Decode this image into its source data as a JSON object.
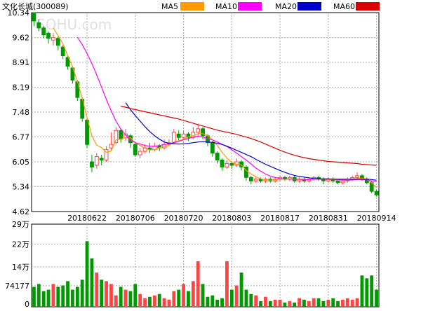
{
  "header": {
    "title": "文化长城(300089)",
    "watermark": "SOHU.com",
    "legend": [
      {
        "label": "MA5",
        "color": "#ff9900"
      },
      {
        "label": "MA10",
        "color": "#ff00ff"
      },
      {
        "label": "MA20",
        "color": "#0000cc"
      },
      {
        "label": "MA60",
        "color": "#dd0000"
      }
    ]
  },
  "colors": {
    "up": "#ff4444",
    "down": "#009900",
    "grid": "#aaaaaa",
    "axis": "#000000"
  },
  "chart_data": [
    {
      "type": "candlestick",
      "title": "文化长城(300089)",
      "y_ticks": [
        "10.34",
        "9.62",
        "8.91",
        "8.19",
        "7.48",
        "6.77",
        "6.05",
        "5.34",
        "4.62"
      ],
      "ylim": [
        4.62,
        10.34
      ],
      "x_ticks": [
        {
          "label": "20180622",
          "index": 11
        },
        {
          "label": "20180706",
          "index": 21
        },
        {
          "label": "20180720",
          "index": 31
        },
        {
          "label": "20180803",
          "index": 41
        },
        {
          "label": "20180817",
          "index": 51
        },
        {
          "label": "20180831",
          "index": 61
        },
        {
          "label": "20180914",
          "index": 71
        }
      ],
      "ohlc": [
        [
          10.34,
          10.1,
          10.3,
          9.95
        ],
        [
          10.05,
          9.9,
          10.15,
          9.8
        ],
        [
          9.9,
          9.7,
          9.95,
          9.6
        ],
        [
          9.75,
          9.6,
          9.8,
          9.45
        ],
        [
          9.55,
          9.62,
          9.75,
          9.4
        ],
        [
          9.6,
          9.4,
          9.65,
          9.25
        ],
        [
          9.35,
          9.1,
          9.4,
          9.0
        ],
        [
          9.05,
          8.8,
          9.1,
          8.7
        ],
        [
          8.75,
          8.4,
          8.8,
          8.3
        ],
        [
          8.35,
          7.9,
          8.4,
          7.8
        ],
        [
          7.85,
          7.3,
          7.9,
          7.2
        ],
        [
          7.25,
          6.55,
          7.3,
          6.45
        ],
        [
          6.05,
          5.9,
          6.25,
          5.75
        ],
        [
          5.95,
          6.2,
          6.3,
          5.85
        ],
        [
          6.15,
          6.1,
          6.25,
          5.95
        ],
        [
          6.1,
          6.4,
          6.5,
          6.05
        ],
        [
          6.45,
          6.55,
          6.9,
          6.4
        ],
        [
          6.6,
          6.95,
          7.05,
          6.55
        ],
        [
          6.95,
          6.7,
          7.0,
          6.6
        ],
        [
          6.75,
          6.85,
          7.0,
          6.65
        ],
        [
          6.8,
          6.6,
          6.85,
          6.45
        ],
        [
          6.55,
          6.25,
          6.6,
          6.2
        ],
        [
          6.25,
          6.35,
          6.45,
          6.15
        ],
        [
          6.35,
          6.45,
          6.55,
          6.3
        ],
        [
          6.45,
          6.4,
          6.6,
          6.3
        ],
        [
          6.4,
          6.5,
          6.6,
          6.35
        ],
        [
          6.5,
          6.45,
          6.55,
          6.35
        ],
        [
          6.45,
          6.55,
          6.7,
          6.4
        ],
        [
          6.55,
          6.6,
          6.7,
          6.5
        ],
        [
          6.6,
          6.9,
          7.0,
          6.55
        ],
        [
          6.85,
          6.75,
          6.95,
          6.65
        ],
        [
          6.75,
          6.85,
          6.95,
          6.7
        ],
        [
          6.85,
          6.75,
          6.9,
          6.65
        ],
        [
          6.75,
          6.9,
          7.05,
          6.7
        ],
        [
          6.9,
          7.0,
          7.15,
          6.8
        ],
        [
          7.0,
          6.8,
          7.05,
          6.7
        ],
        [
          6.8,
          6.6,
          6.85,
          6.5
        ],
        [
          6.6,
          6.3,
          6.65,
          6.2
        ],
        [
          6.3,
          6.1,
          6.35,
          6.0
        ],
        [
          6.1,
          5.9,
          6.15,
          5.8
        ],
        [
          5.9,
          6.0,
          6.1,
          5.85
        ],
        [
          6.0,
          5.95,
          6.05,
          5.85
        ],
        [
          5.95,
          6.05,
          6.15,
          5.9
        ],
        [
          6.05,
          5.9,
          6.1,
          5.8
        ],
        [
          5.9,
          5.6,
          5.95,
          5.5
        ],
        [
          5.6,
          5.5,
          5.65,
          5.4
        ],
        [
          5.5,
          5.55,
          5.6,
          5.45
        ],
        [
          5.55,
          5.5,
          5.6,
          5.45
        ],
        [
          5.5,
          5.55,
          5.6,
          5.45
        ],
        [
          5.55,
          5.5,
          5.6,
          5.45
        ],
        [
          5.5,
          5.55,
          5.6,
          5.45
        ],
        [
          5.55,
          5.6,
          5.65,
          5.5
        ],
        [
          5.6,
          5.55,
          5.65,
          5.5
        ],
        [
          5.55,
          5.6,
          5.65,
          5.5
        ],
        [
          5.6,
          5.5,
          5.65,
          5.45
        ],
        [
          5.5,
          5.55,
          5.6,
          5.45
        ],
        [
          5.55,
          5.5,
          5.6,
          5.45
        ],
        [
          5.5,
          5.55,
          5.6,
          5.45
        ],
        [
          5.55,
          5.6,
          5.65,
          5.5
        ],
        [
          5.6,
          5.55,
          5.65,
          5.5
        ],
        [
          5.55,
          5.5,
          5.6,
          5.4
        ],
        [
          5.5,
          5.55,
          5.6,
          5.45
        ],
        [
          5.55,
          5.5,
          5.6,
          5.45
        ],
        [
          5.5,
          5.45,
          5.55,
          5.4
        ],
        [
          5.45,
          5.5,
          5.55,
          5.4
        ],
        [
          5.5,
          5.55,
          5.6,
          5.45
        ],
        [
          5.55,
          5.6,
          5.65,
          5.5
        ],
        [
          5.6,
          5.65,
          5.75,
          5.55
        ],
        [
          5.65,
          5.55,
          5.7,
          5.5
        ],
        [
          5.55,
          5.45,
          5.6,
          5.4
        ],
        [
          5.45,
          5.2,
          5.5,
          5.15
        ],
        [
          5.2,
          5.1,
          5.25,
          5.05
        ]
      ],
      "ma": [
        {
          "name": "MA5",
          "color": "#ff9900",
          "values": [
            null,
            null,
            null,
            null,
            9.9,
            9.68,
            9.44,
            9.1,
            8.78,
            8.36,
            7.88,
            7.32,
            6.8,
            6.53,
            6.46,
            6.32,
            6.36,
            6.68,
            6.7,
            6.75,
            6.74,
            6.6,
            6.52,
            6.44,
            6.39,
            6.4,
            6.45,
            6.49,
            6.52,
            6.62,
            6.65,
            6.7,
            6.77,
            6.8,
            6.86,
            6.86,
            6.8,
            6.68,
            6.52,
            6.32,
            6.16,
            6.03,
            5.98,
            5.96,
            5.8,
            5.7,
            5.62,
            5.56,
            5.53,
            5.52,
            5.53,
            5.55,
            5.55,
            5.56,
            5.55,
            5.54,
            5.54,
            5.54,
            5.55,
            5.55,
            5.55,
            5.54,
            5.54,
            5.52,
            5.52,
            5.51,
            5.53,
            5.57,
            5.58,
            5.55,
            5.45,
            5.31
          ]
        },
        {
          "name": "MA10",
          "color": "#ff00ff",
          "values": [
            null,
            null,
            null,
            null,
            null,
            null,
            null,
            null,
            null,
            9.64,
            9.42,
            9.16,
            8.88,
            8.55,
            8.2,
            7.84,
            7.52,
            7.22,
            6.99,
            6.82,
            6.68,
            6.6,
            6.56,
            6.52,
            6.5,
            6.5,
            6.52,
            6.55,
            6.57,
            6.6,
            6.64,
            6.68,
            6.72,
            6.76,
            6.79,
            6.76,
            6.72,
            6.68,
            6.62,
            6.55,
            6.49,
            6.4,
            6.3,
            6.2,
            6.1,
            5.99,
            5.87,
            5.78,
            5.7,
            5.64,
            5.6,
            5.57,
            5.56,
            5.55,
            5.55,
            5.55,
            5.54,
            5.54,
            5.55,
            5.55,
            5.55,
            5.55,
            5.55,
            5.54,
            5.53,
            5.52,
            5.53,
            5.54,
            5.54,
            5.53,
            5.5,
            5.48
          ]
        },
        {
          "name": "MA20",
          "color": "#0000cc",
          "values": [
            null,
            null,
            null,
            null,
            null,
            null,
            null,
            null,
            null,
            null,
            null,
            null,
            null,
            null,
            null,
            null,
            null,
            null,
            null,
            7.75,
            7.55,
            7.38,
            7.22,
            7.06,
            6.92,
            6.8,
            6.7,
            6.62,
            6.58,
            6.57,
            6.56,
            6.57,
            6.58,
            6.6,
            6.62,
            6.63,
            6.62,
            6.61,
            6.58,
            6.55,
            6.5,
            6.44,
            6.38,
            6.32,
            6.26,
            6.2,
            6.12,
            6.05,
            5.98,
            5.92,
            5.86,
            5.8,
            5.75,
            5.7,
            5.66,
            5.63,
            5.61,
            5.59,
            5.57,
            5.56,
            5.56,
            5.56,
            5.55,
            5.55,
            5.55,
            5.55,
            5.55,
            5.55,
            5.55,
            5.55,
            5.54,
            5.52
          ]
        },
        {
          "name": "MA60",
          "color": "#dd0000",
          "values": [
            null,
            null,
            null,
            null,
            null,
            null,
            null,
            null,
            null,
            null,
            null,
            null,
            null,
            null,
            null,
            null,
            null,
            null,
            7.65,
            7.62,
            7.58,
            7.55,
            7.52,
            7.49,
            7.46,
            7.43,
            7.4,
            7.37,
            7.34,
            7.31,
            7.28,
            7.24,
            7.2,
            7.16,
            7.12,
            7.08,
            7.04,
            7.0,
            6.96,
            6.93,
            6.9,
            6.87,
            6.84,
            6.8,
            6.76,
            6.72,
            6.67,
            6.62,
            6.56,
            6.5,
            6.44,
            6.38,
            6.33,
            6.28,
            6.24,
            6.2,
            6.17,
            6.14,
            6.12,
            6.1,
            6.08,
            6.06,
            6.05,
            6.04,
            6.03,
            6.02,
            6.01,
            6.0,
            5.98,
            5.97,
            5.96,
            5.95
          ]
        }
      ]
    },
    {
      "type": "bar",
      "y_ticks": [
        "29万",
        "22万",
        "14万",
        "74177",
        "0"
      ],
      "y_tick_values": [
        290000,
        220000,
        140000,
        74177,
        0
      ],
      "ylim": [
        0,
        290000
      ],
      "values": [
        70000,
        80000,
        55000,
        60000,
        80000,
        70000,
        75000,
        90000,
        60000,
        70000,
        95000,
        230000,
        170000,
        120000,
        95000,
        90000,
        80000,
        40000,
        70000,
        60000,
        55000,
        80000,
        45000,
        30000,
        35000,
        40000,
        45000,
        30000,
        25000,
        55000,
        60000,
        80000,
        55000,
        90000,
        160000,
        80000,
        35000,
        40000,
        25000,
        30000,
        160000,
        60000,
        75000,
        120000,
        60000,
        45000,
        40000,
        20000,
        35000,
        20000,
        25000,
        25000,
        15000,
        20000,
        15000,
        30000,
        25000,
        20000,
        30000,
        30000,
        20000,
        25000,
        30000,
        20000,
        25000,
        30000,
        25000,
        30000,
        110000,
        100000,
        110000,
        60000
      ]
    }
  ]
}
